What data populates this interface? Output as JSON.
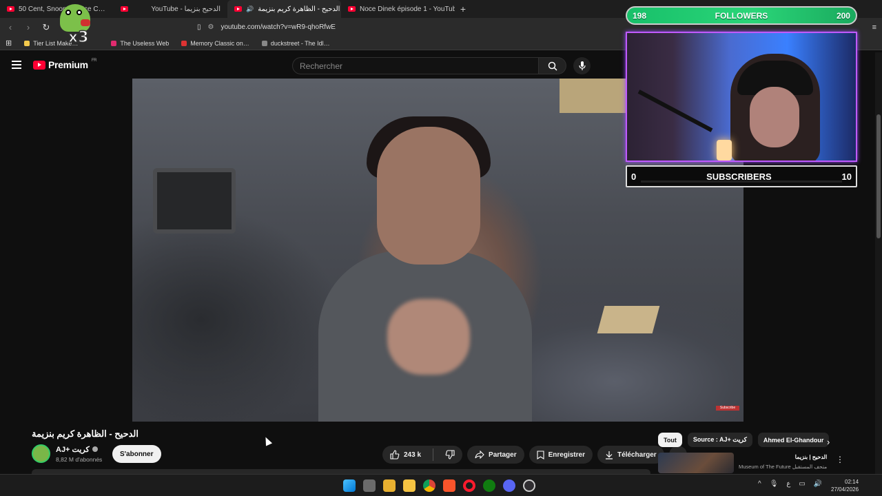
{
  "browser": {
    "tabs": [
      {
        "label": "50 Cent, Snoop D… Ice C…",
        "active": false
      },
      {
        "label": "YouTube - الدحيح بنزيما",
        "active": false
      },
      {
        "label": "الدحيح - الظاهرة كريم بنزيمة -",
        "active": true
      },
      {
        "label": "Noce Dinek épisode 1 - YouTube",
        "active": false
      }
    ],
    "close_glyph": "✕",
    "new_tab_glyph": "+",
    "url": "youtube.com/watch?v=wR9-qhoRfwE",
    "bookmarks": [
      {
        "label": "Tier List Make…",
        "color": "#f2c94c"
      },
      {
        "label": "The Useless Web",
        "color": "#e02b6f"
      },
      {
        "label": "Memory Classic on…",
        "color": "#d33"
      },
      {
        "label": "duckstreet - The Idl…",
        "color": "#888"
      }
    ]
  },
  "youtube": {
    "logo_text": "Premium",
    "logo_region": "FR",
    "search_placeholder": "Rechercher",
    "video": {
      "title": "الدحيح - الظاهرة كريم بنزيمة",
      "channel_name": "AJ+ كريت",
      "subscribers": "8,82 M d'abonnés",
      "subscribe_label": "S'abonner",
      "likes": "243 k",
      "share_label": "Partager",
      "save_label": "Enregistrer",
      "download_label": "Télécharger",
      "watermark": "Subscribe"
    },
    "chips": [
      {
        "label": "Tout",
        "selected": true
      },
      {
        "label": "Source : AJ+ كريت",
        "selected": false
      },
      {
        "label": "Ahmed El-Ghandour",
        "selected": false
      }
    ],
    "recommendation": {
      "title": "الدحيح | بنزيما",
      "channel": "Museum of The Future متحف المستقبل"
    }
  },
  "overlay": {
    "followers": {
      "label": "FOLLOWERS",
      "current": "198",
      "goal": "200"
    },
    "subscribers": {
      "label": "SUBSCRIBERS",
      "current": "0",
      "goal": "10"
    },
    "multiplier": "x3"
  },
  "taskbar": {
    "time": "02:14",
    "date": "27/04/2026",
    "input_lang": "ع"
  }
}
